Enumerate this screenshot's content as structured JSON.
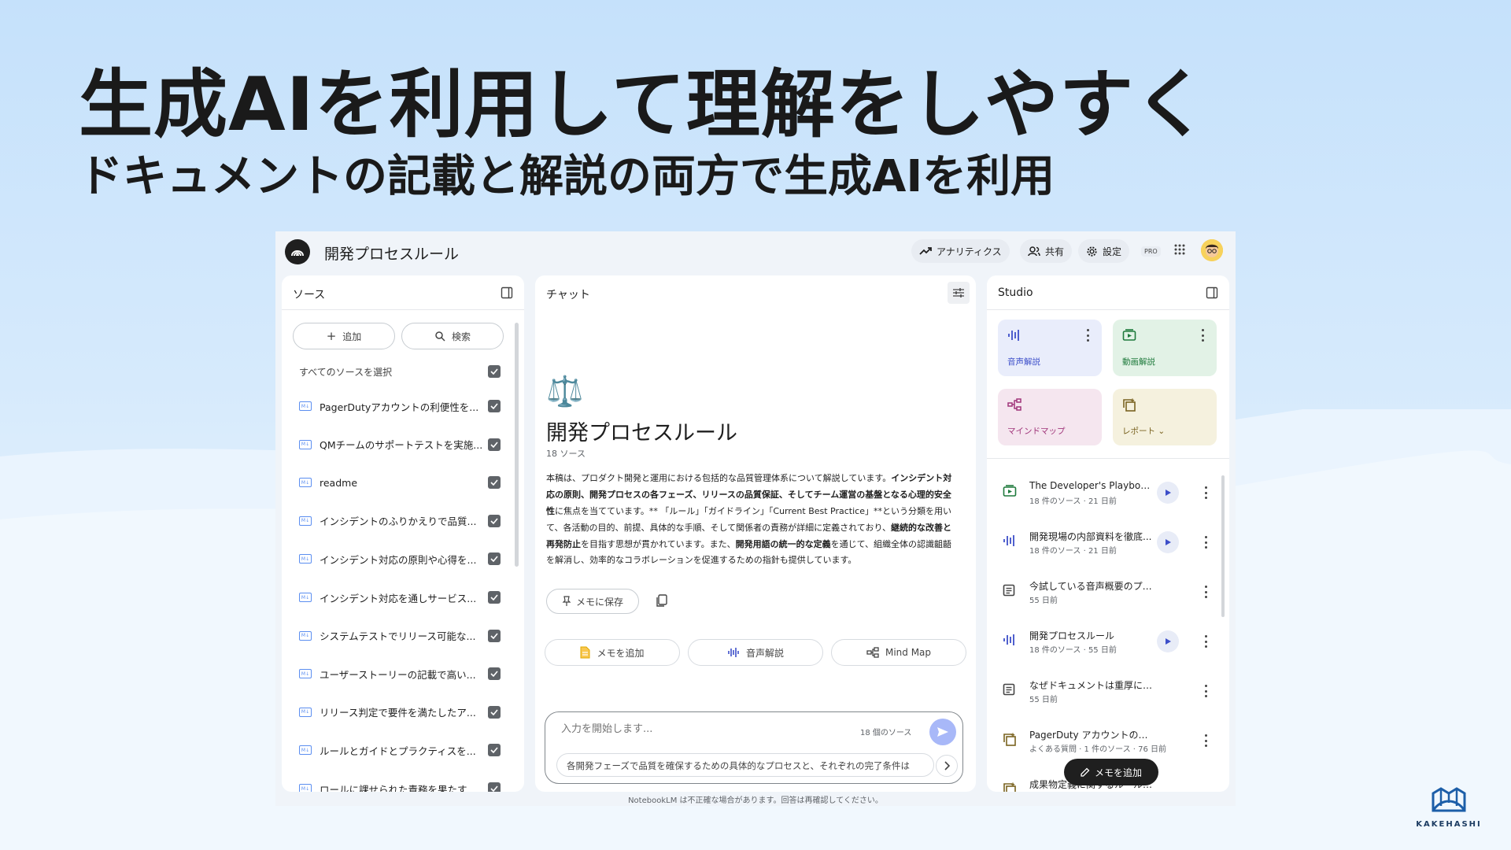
{
  "hero": {
    "title": "生成AIを利用して理解をしやすく",
    "subtitle": "ドキュメントの記載と解説の両方で生成AIを利用"
  },
  "app": {
    "notebook_title": "開発プロセスルール",
    "toolbar": {
      "analytics": "アナリティクス",
      "share": "共有",
      "settings": "設定",
      "pro_badge": "PRO"
    },
    "sources_panel": {
      "title": "ソース",
      "add_label": "追加",
      "search_label": "検索",
      "select_all": "すべてのソースを選択",
      "items": [
        "PagerDutyアカウントの利便性を...",
        "QMチームのサポートテストを実施...",
        "readme",
        "インシデントのふりかえりで品質...",
        "インシデント対応の原則や心得を...",
        "インシデント対応を通しサービス...",
        "システムテストでリリース可能な...",
        "ユーザーストーリーの記載で高い...",
        "リリース判定で要件を満たしたア...",
        "ルールとガイドとプラクティスを...",
        "ロールに課せられた責務を果たす"
      ]
    },
    "chat_panel": {
      "title": "チャット",
      "nb_emoji": "⚖️",
      "nb_title": "開発プロセスルール",
      "source_count": "18 ソース",
      "summary_parts": [
        {
          "text": "本稿は、",
          "bold": false
        },
        {
          "text": "プロダクト開発と運用における包括的な品質管理体系",
          "bold": false
        },
        {
          "text": "について解説しています。",
          "bold": false
        },
        {
          "text": "インシデント対応の原則、開発プロセスの各フェーズ、リリースの品質保証、そしてチーム運営の基盤となる心理的安全性",
          "bold": true
        },
        {
          "text": "に焦点を当てています。** 「ルール」「ガイドライン」「Current Best Practice」**という分類を用いて、各活動の目的、前提、具体的な手順、そして関係者の責務が詳細に定義されており、",
          "bold": false
        },
        {
          "text": "継続的な改善と再発防止",
          "bold": true
        },
        {
          "text": "を目指す思想が貫かれています。また、",
          "bold": false
        },
        {
          "text": "開発用語の統一的な定義",
          "bold": true
        },
        {
          "text": "を通じて、組織全体の認識齟齬を解消し、効率的なコラボレーションを促進するための指針も提供しています。",
          "bold": false
        }
      ],
      "save_memo": "メモに保存",
      "suggestions": [
        "メモを追加",
        "音声解説",
        "Mind Map"
      ],
      "input_placeholder": "入力を開始します...",
      "input_source_count": "18 個のソース",
      "suggested_question": "各開発フェーズで品質を確保するための具体的なプロセスと、それぞれの完了条件は",
      "disclaimer": "NotebookLM は不正確な場合があります。回答は再確認してください。"
    },
    "studio_panel": {
      "title": "Studio",
      "cards": [
        {
          "label": "音声解説",
          "icon": "audio-wave-icon",
          "bg": "#e9edfb",
          "fg": "#3c4ec9"
        },
        {
          "label": "動画解説",
          "icon": "video-icon",
          "bg": "#e2f2e6",
          "fg": "#1e7a3c"
        },
        {
          "label": "マインドマップ",
          "icon": "mindmap-icon",
          "bg": "#f5e6ef",
          "fg": "#a0357a"
        },
        {
          "label": "レポート",
          "icon": "report-icon",
          "bg": "#f5f1de",
          "fg": "#7a6320"
        }
      ],
      "notes": [
        {
          "title": "The Developer's Playbook...",
          "meta": "18 件のソース · 21 日前",
          "icon": "video-icon",
          "play": true
        },
        {
          "title": "開発現場の内部資料を徹底...",
          "meta": "18 件のソース · 21 日前",
          "icon": "audio-wave-icon",
          "play": true
        },
        {
          "title": "今試している音声概要のプロンプ...",
          "meta": "55 日前",
          "icon": "note-icon",
          "play": false
        },
        {
          "title": "開発プロセスルール",
          "meta": "18 件のソース · 55 日前",
          "icon": "audio-wave-icon",
          "play": true
        },
        {
          "title": "なぜドキュメントは重厚に感じる...",
          "meta": "55 日前",
          "icon": "note-icon",
          "play": false
        },
        {
          "title": "PagerDuty アカウントのベスト...",
          "meta": "よくある質問 · 1 件のソース · 76 日前",
          "icon": "report-icon",
          "play": false
        },
        {
          "title": "成果物定義に関するルールと用語...",
          "meta": "",
          "icon": "report-icon",
          "play": false
        }
      ],
      "add_note": "メモを追加"
    }
  },
  "brand": {
    "name": "KAKEHASHI"
  },
  "colors": {
    "accent": "#3c4ec9",
    "send": "#a8b8f8"
  }
}
